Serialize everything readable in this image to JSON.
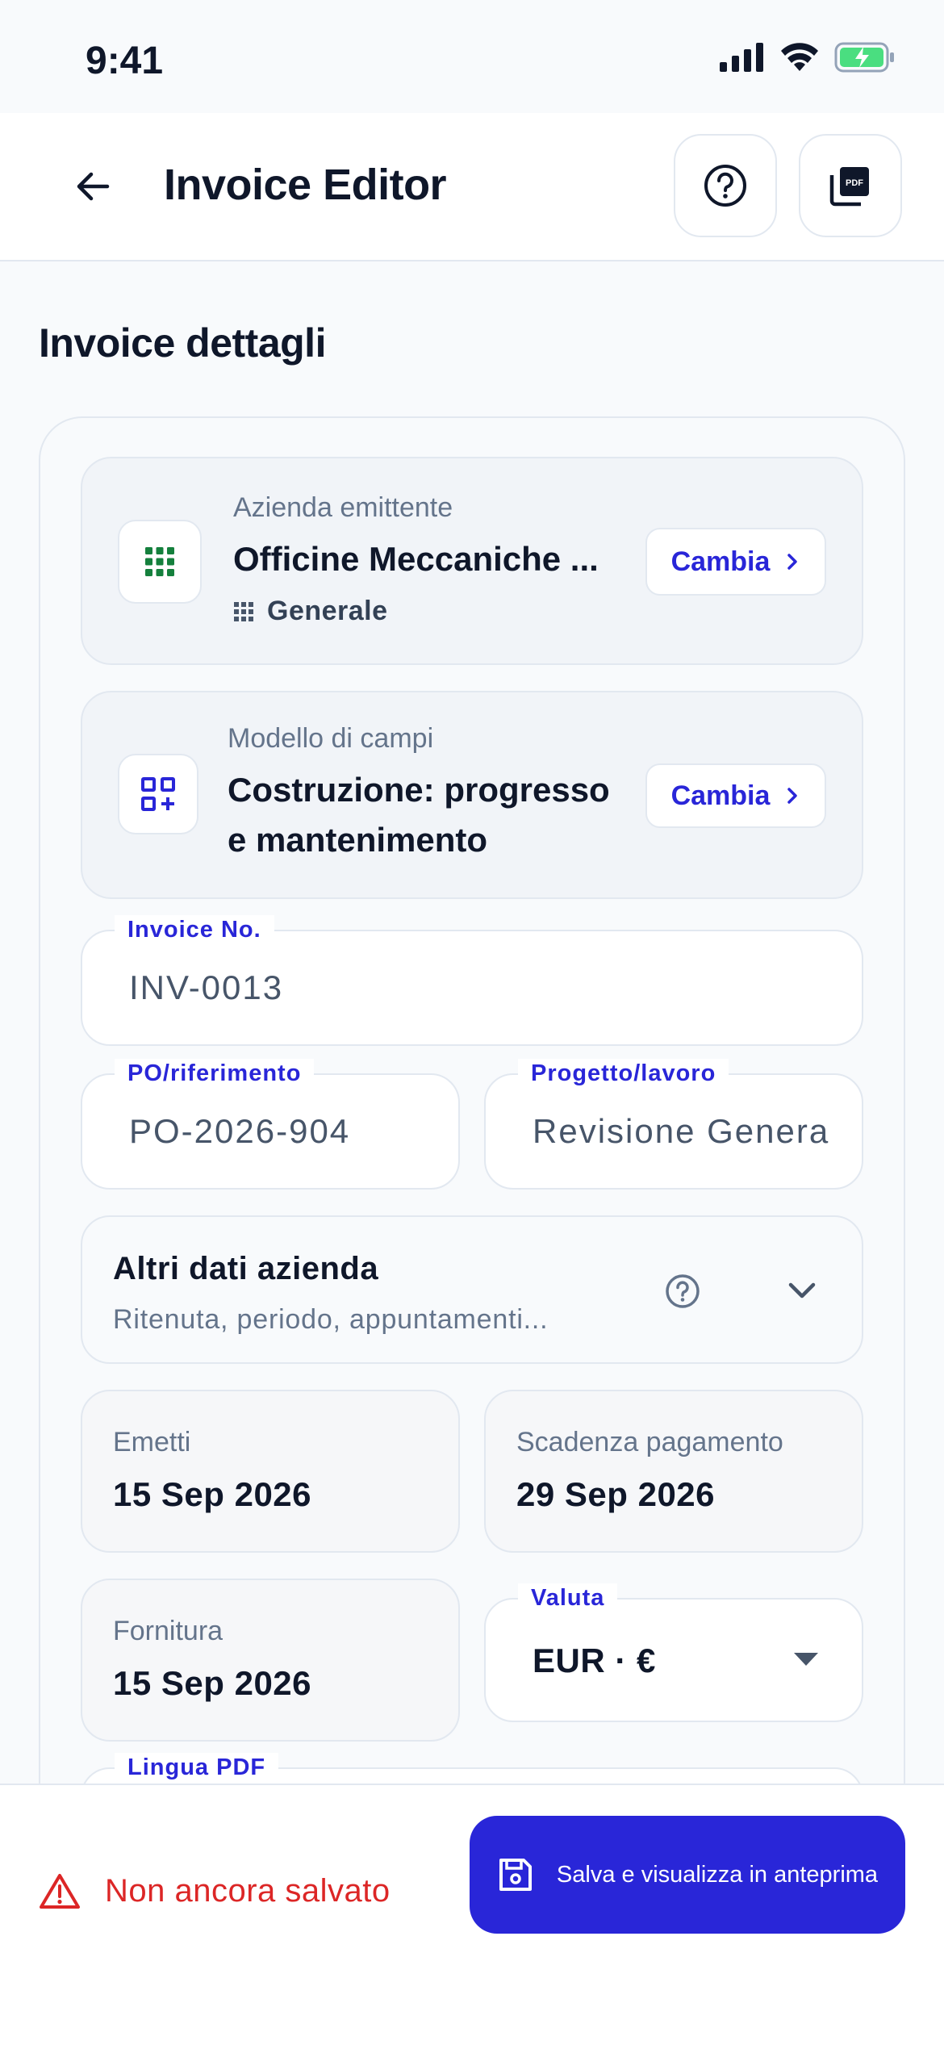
{
  "status": {
    "time": "9:41"
  },
  "appbar": {
    "title": "Invoice Editor"
  },
  "section_title": "Invoice dettagli",
  "issuer": {
    "small": "Azienda emittente",
    "name": "Officine Meccaniche ...",
    "category": "Generale",
    "change_label": "Cambia"
  },
  "template": {
    "small": "Modello di campi",
    "name_line1": "Costruzione: progresso",
    "name_line2": "e mantenimento",
    "change_label": "Cambia"
  },
  "fields": {
    "invoice_no": {
      "label": "Invoice No.",
      "value": "INV-0013"
    },
    "po_ref": {
      "label": "PO/riferimento",
      "value": "PO-2026-904"
    },
    "project": {
      "label": "Progetto/lavoro",
      "value": "Revisione Genera"
    },
    "currency": {
      "label": "Valuta",
      "value": "EUR · €"
    },
    "pdf_lang": {
      "label": "Lingua PDF"
    }
  },
  "other_data": {
    "title": "Altri dati azienda",
    "subtitle": "Ritenuta, periodo, appuntamenti..."
  },
  "dates": {
    "issue": {
      "label": "Emetti",
      "value": "15 Sep 2026"
    },
    "due": {
      "label": "Scadenza pagamento",
      "value": "29 Sep 2026"
    },
    "supply": {
      "label": "Fornitura",
      "value": "15 Sep 2026"
    }
  },
  "footer": {
    "unsaved": "Non ancora salvato",
    "save_button": "Salva e visualizza in anteprima"
  },
  "colors": {
    "accent": "#2926d8",
    "danger": "#dc2626",
    "green": "#15803d"
  }
}
